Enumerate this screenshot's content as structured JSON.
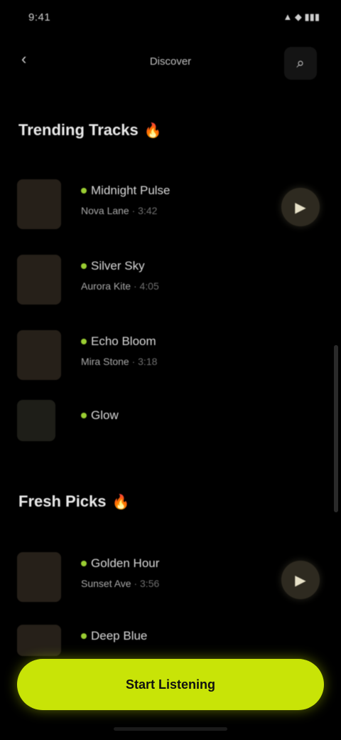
{
  "status": {
    "time": "9:41",
    "icons": "▲ ◆ ▮▮▮"
  },
  "nav": {
    "back_icon": "‹",
    "title": "Discover",
    "action_icon": "⌕"
  },
  "sections": [
    {
      "title": "Trending Tracks",
      "items": [
        {
          "title": "Midnight Pulse",
          "artist": "Nova Lane",
          "meta": "· 3:42"
        },
        {
          "title": "Silver Sky",
          "artist": "Aurora Kite",
          "meta": "· 4:05"
        },
        {
          "title": "Echo Bloom",
          "artist": "Mira Stone",
          "meta": "· 3:18"
        },
        {
          "title": "Glow",
          "artist": "",
          "meta": ""
        }
      ]
    },
    {
      "title": "Fresh Picks",
      "items": [
        {
          "title": "Golden Hour",
          "artist": "Sunset Ave",
          "meta": "· 3:56"
        },
        {
          "title": "Deep Blue",
          "artist": "",
          "meta": ""
        }
      ]
    }
  ],
  "cta": {
    "label": "Start Listening"
  },
  "colors": {
    "accent": "#c8e407",
    "flame": "#ff9b3d"
  }
}
